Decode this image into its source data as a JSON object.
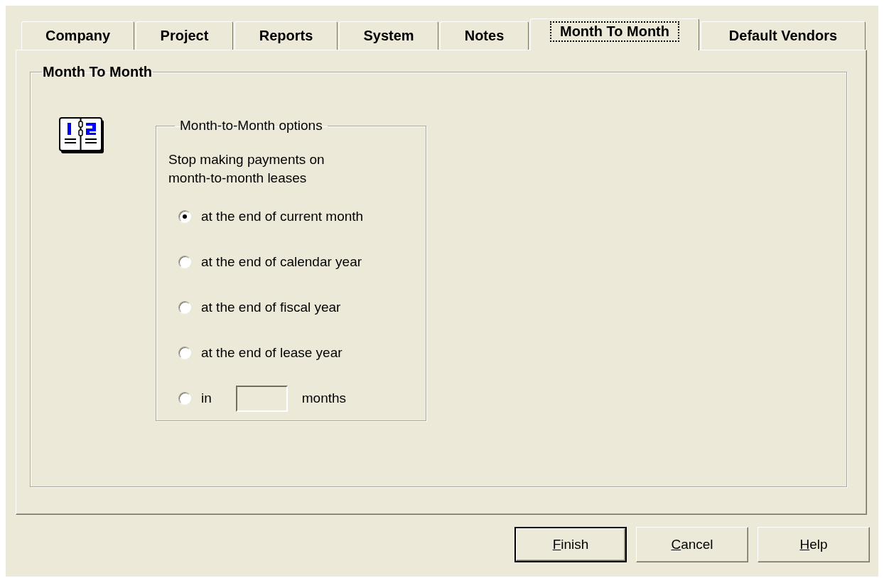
{
  "tabs": [
    {
      "label": "Company",
      "selected": false
    },
    {
      "label": "Project",
      "selected": false
    },
    {
      "label": "Reports",
      "selected": false
    },
    {
      "label": "System",
      "selected": false
    },
    {
      "label": "Notes",
      "selected": false
    },
    {
      "label": "Month To Month",
      "selected": true
    },
    {
      "label": "Default Vendors",
      "selected": false
    }
  ],
  "panel": {
    "title": "Month To Month",
    "options": {
      "title": "Month-to-Month options",
      "description": "Stop making payments on month-to-month leases",
      "radios": [
        {
          "kind": "plain",
          "label": "at the end of current month",
          "selected": true
        },
        {
          "kind": "plain",
          "label": "at the end of calendar year",
          "selected": false
        },
        {
          "kind": "plain",
          "label": "at the end of fiscal year",
          "selected": false
        },
        {
          "kind": "plain",
          "label": "at the end of lease year",
          "selected": false
        },
        {
          "kind": "count",
          "label": "in",
          "unit": "months",
          "selected": false
        }
      ]
    }
  },
  "buttons": [
    {
      "label": "Finish",
      "default": true,
      "underline_first": true
    },
    {
      "label": "Cancel",
      "default": false,
      "underline_first": true
    },
    {
      "label": "Help",
      "default": false,
      "underline_first": true
    }
  ]
}
